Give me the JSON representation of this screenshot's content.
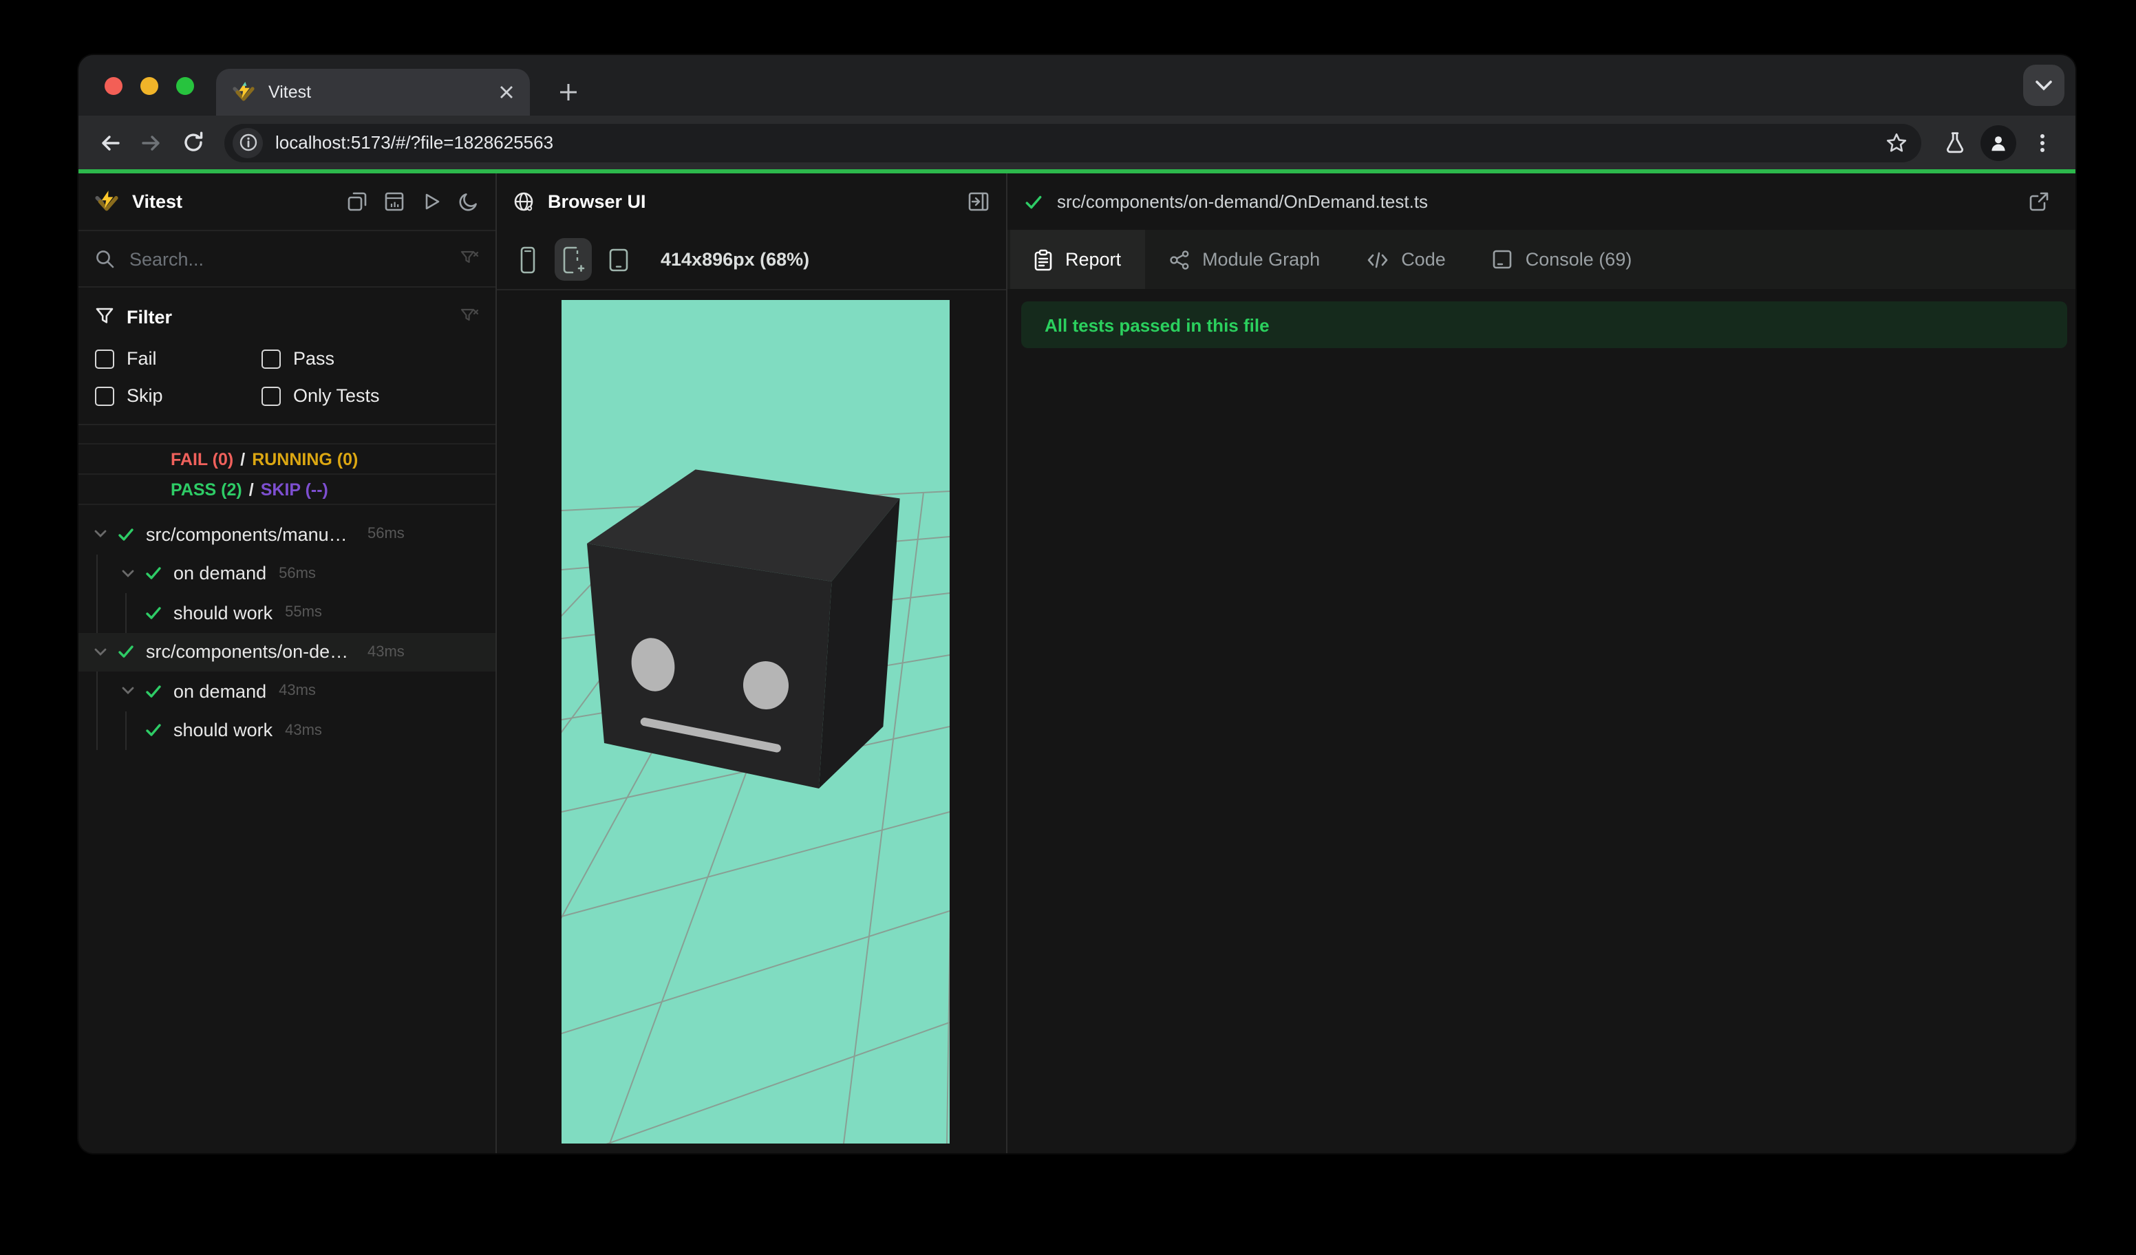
{
  "window": {
    "tab_title": "Vitest",
    "url": "localhost:5173/#/?file=1828625563"
  },
  "sidebar": {
    "app_title": "Vitest",
    "search_placeholder": "Search...",
    "filter": {
      "title": "Filter",
      "options": [
        "Fail",
        "Pass",
        "Skip",
        "Only Tests"
      ]
    },
    "summary": {
      "fail": "FAIL (0)",
      "running": "RUNNING (0)",
      "pass": "PASS (2)",
      "skip": "SKIP (--)",
      "separator": "/"
    },
    "tree": [
      {
        "label": "src/components/manual/…",
        "duration": "56ms",
        "depth": 0,
        "status": "pass"
      },
      {
        "label": "on demand",
        "duration": "56ms",
        "depth": 1,
        "status": "pass"
      },
      {
        "label": "should work",
        "duration": "55ms",
        "depth": 2,
        "status": "pass"
      },
      {
        "label": "src/components/on-dema…",
        "duration": "43ms",
        "depth": 0,
        "status": "pass",
        "selected": true
      },
      {
        "label": "on demand",
        "duration": "43ms",
        "depth": 1,
        "status": "pass"
      },
      {
        "label": "should work",
        "duration": "43ms",
        "depth": 2,
        "status": "pass"
      }
    ]
  },
  "preview": {
    "title": "Browser UI",
    "viewport_label": "414x896px (68%)"
  },
  "report": {
    "file_path": "src/components/on-demand/OnDemand.test.ts",
    "tabs": [
      "Report",
      "Module Graph",
      "Code",
      "Console (69)"
    ],
    "active_tab": "Report",
    "banner": "All tests passed in this file"
  },
  "colors": {
    "progress-green": "#2db84c",
    "pass-green": "#2ecc66",
    "fail-red": "#f0615c",
    "running-amber": "#dca712",
    "skip-purple": "#7d4fd0",
    "teal-bg": "#80dcc1",
    "grid-line": "#8c9189",
    "cube-top": "#2d2d2e",
    "cube-front": "#242425",
    "cube-right": "#1b1b1c",
    "face-gray": "#b5b5b5",
    "banner-bg": "#152a1c",
    "banner-text": "#2bd05e"
  }
}
